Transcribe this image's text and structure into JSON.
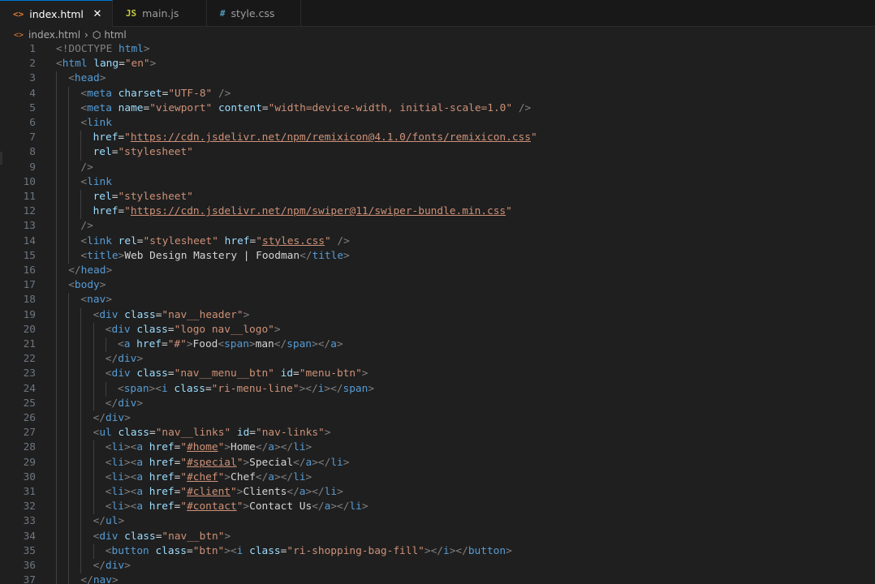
{
  "tabs": [
    {
      "label": "index.html",
      "icon": "<>",
      "icon_color": "#e37933",
      "active": true
    },
    {
      "label": "main.js",
      "icon": "JS",
      "icon_color": "#cbcb41",
      "active": false
    },
    {
      "label": "style.css",
      "icon": "#",
      "icon_color": "#519aba",
      "active": false
    }
  ],
  "breadcrumb": {
    "file": "index.html",
    "symbol": "html"
  },
  "lines": [
    {
      "n": "1",
      "indent": 0,
      "tokens": [
        [
          "punct",
          "<!DOCTYPE "
        ],
        [
          "tag",
          "html"
        ],
        [
          "punct",
          ">"
        ]
      ]
    },
    {
      "n": "2",
      "indent": 0,
      "tokens": [
        [
          "punct",
          "<"
        ],
        [
          "tag",
          "html"
        ],
        [
          "text",
          " "
        ],
        [
          "attr",
          "lang"
        ],
        [
          "text",
          "="
        ],
        [
          "str",
          "\"en\""
        ],
        [
          "punct",
          ">"
        ]
      ]
    },
    {
      "n": "3",
      "indent": 1,
      "tokens": [
        [
          "punct",
          "<"
        ],
        [
          "tag",
          "head"
        ],
        [
          "punct",
          ">"
        ]
      ]
    },
    {
      "n": "4",
      "indent": 2,
      "tokens": [
        [
          "punct",
          "<"
        ],
        [
          "tag",
          "meta"
        ],
        [
          "text",
          " "
        ],
        [
          "attr",
          "charset"
        ],
        [
          "text",
          "="
        ],
        [
          "str",
          "\"UTF-8\""
        ],
        [
          "text",
          " "
        ],
        [
          "punct",
          "/>"
        ]
      ]
    },
    {
      "n": "5",
      "indent": 2,
      "tokens": [
        [
          "punct",
          "<"
        ],
        [
          "tag",
          "meta"
        ],
        [
          "text",
          " "
        ],
        [
          "attr",
          "name"
        ],
        [
          "text",
          "="
        ],
        [
          "str",
          "\"viewport\""
        ],
        [
          "text",
          " "
        ],
        [
          "attr",
          "content"
        ],
        [
          "text",
          "="
        ],
        [
          "str",
          "\"width=device-width, initial-scale=1.0\""
        ],
        [
          "text",
          " "
        ],
        [
          "punct",
          "/>"
        ]
      ]
    },
    {
      "n": "6",
      "indent": 2,
      "tokens": [
        [
          "punct",
          "<"
        ],
        [
          "tag",
          "link"
        ]
      ]
    },
    {
      "n": "7",
      "indent": 3,
      "tokens": [
        [
          "attr",
          "href"
        ],
        [
          "text",
          "="
        ],
        [
          "str",
          "\""
        ],
        [
          "link",
          "https://cdn.jsdelivr.net/npm/remixicon@4.1.0/fonts/remixicon.css"
        ],
        [
          "str",
          "\""
        ]
      ]
    },
    {
      "n": "8",
      "indent": 3,
      "tokens": [
        [
          "attr",
          "rel"
        ],
        [
          "text",
          "="
        ],
        [
          "str",
          "\"stylesheet\""
        ]
      ]
    },
    {
      "n": "9",
      "indent": 2,
      "tokens": [
        [
          "punct",
          "/>"
        ]
      ]
    },
    {
      "n": "10",
      "indent": 2,
      "tokens": [
        [
          "punct",
          "<"
        ],
        [
          "tag",
          "link"
        ]
      ]
    },
    {
      "n": "11",
      "indent": 3,
      "tokens": [
        [
          "attr",
          "rel"
        ],
        [
          "text",
          "="
        ],
        [
          "str",
          "\"stylesheet\""
        ]
      ]
    },
    {
      "n": "12",
      "indent": 3,
      "tokens": [
        [
          "attr",
          "href"
        ],
        [
          "text",
          "="
        ],
        [
          "str",
          "\""
        ],
        [
          "link",
          "https://cdn.jsdelivr.net/npm/swiper@11/swiper-bundle.min.css"
        ],
        [
          "str",
          "\""
        ]
      ]
    },
    {
      "n": "13",
      "indent": 2,
      "tokens": [
        [
          "punct",
          "/>"
        ]
      ]
    },
    {
      "n": "14",
      "indent": 2,
      "tokens": [
        [
          "punct",
          "<"
        ],
        [
          "tag",
          "link"
        ],
        [
          "text",
          " "
        ],
        [
          "attr",
          "rel"
        ],
        [
          "text",
          "="
        ],
        [
          "str",
          "\"stylesheet\""
        ],
        [
          "text",
          " "
        ],
        [
          "attr",
          "href"
        ],
        [
          "text",
          "="
        ],
        [
          "str",
          "\""
        ],
        [
          "link",
          "styles.css"
        ],
        [
          "str",
          "\""
        ],
        [
          "text",
          " "
        ],
        [
          "punct",
          "/>"
        ]
      ]
    },
    {
      "n": "15",
      "indent": 2,
      "tokens": [
        [
          "punct",
          "<"
        ],
        [
          "tag",
          "title"
        ],
        [
          "punct",
          ">"
        ],
        [
          "text",
          "Web Design Mastery | Foodman"
        ],
        [
          "punct",
          "</"
        ],
        [
          "tag",
          "title"
        ],
        [
          "punct",
          ">"
        ]
      ]
    },
    {
      "n": "16",
      "indent": 1,
      "tokens": [
        [
          "punct",
          "</"
        ],
        [
          "tag",
          "head"
        ],
        [
          "punct",
          ">"
        ]
      ]
    },
    {
      "n": "17",
      "indent": 1,
      "tokens": [
        [
          "punct",
          "<"
        ],
        [
          "tag",
          "body"
        ],
        [
          "punct",
          ">"
        ]
      ]
    },
    {
      "n": "18",
      "indent": 2,
      "tokens": [
        [
          "punct",
          "<"
        ],
        [
          "tag",
          "nav"
        ],
        [
          "punct",
          ">"
        ]
      ]
    },
    {
      "n": "19",
      "indent": 3,
      "tokens": [
        [
          "punct",
          "<"
        ],
        [
          "tag",
          "div"
        ],
        [
          "text",
          " "
        ],
        [
          "attr",
          "class"
        ],
        [
          "text",
          "="
        ],
        [
          "str",
          "\"nav__header\""
        ],
        [
          "punct",
          ">"
        ]
      ]
    },
    {
      "n": "20",
      "indent": 4,
      "tokens": [
        [
          "punct",
          "<"
        ],
        [
          "tag",
          "div"
        ],
        [
          "text",
          " "
        ],
        [
          "attr",
          "class"
        ],
        [
          "text",
          "="
        ],
        [
          "str",
          "\"logo nav__logo\""
        ],
        [
          "punct",
          ">"
        ]
      ]
    },
    {
      "n": "21",
      "indent": 5,
      "tokens": [
        [
          "punct",
          "<"
        ],
        [
          "tag",
          "a"
        ],
        [
          "text",
          " "
        ],
        [
          "attr",
          "href"
        ],
        [
          "text",
          "="
        ],
        [
          "str",
          "\"#\""
        ],
        [
          "punct",
          ">"
        ],
        [
          "text",
          "Food"
        ],
        [
          "punct",
          "<"
        ],
        [
          "tag",
          "span"
        ],
        [
          "punct",
          ">"
        ],
        [
          "text",
          "man"
        ],
        [
          "punct",
          "</"
        ],
        [
          "tag",
          "span"
        ],
        [
          "punct",
          "></"
        ],
        [
          "tag",
          "a"
        ],
        [
          "punct",
          ">"
        ]
      ]
    },
    {
      "n": "22",
      "indent": 4,
      "tokens": [
        [
          "punct",
          "</"
        ],
        [
          "tag",
          "div"
        ],
        [
          "punct",
          ">"
        ]
      ]
    },
    {
      "n": "23",
      "indent": 4,
      "tokens": [
        [
          "punct",
          "<"
        ],
        [
          "tag",
          "div"
        ],
        [
          "text",
          " "
        ],
        [
          "attr",
          "class"
        ],
        [
          "text",
          "="
        ],
        [
          "str",
          "\"nav__menu__btn\""
        ],
        [
          "text",
          " "
        ],
        [
          "attr",
          "id"
        ],
        [
          "text",
          "="
        ],
        [
          "str",
          "\"menu-btn\""
        ],
        [
          "punct",
          ">"
        ]
      ]
    },
    {
      "n": "24",
      "indent": 5,
      "tokens": [
        [
          "punct",
          "<"
        ],
        [
          "tag",
          "span"
        ],
        [
          "punct",
          "><"
        ],
        [
          "tag",
          "i"
        ],
        [
          "text",
          " "
        ],
        [
          "attr",
          "class"
        ],
        [
          "text",
          "="
        ],
        [
          "str",
          "\"ri-menu-line\""
        ],
        [
          "punct",
          "></"
        ],
        [
          "tag",
          "i"
        ],
        [
          "punct",
          "></"
        ],
        [
          "tag",
          "span"
        ],
        [
          "punct",
          ">"
        ]
      ]
    },
    {
      "n": "25",
      "indent": 4,
      "tokens": [
        [
          "punct",
          "</"
        ],
        [
          "tag",
          "div"
        ],
        [
          "punct",
          ">"
        ]
      ]
    },
    {
      "n": "26",
      "indent": 3,
      "tokens": [
        [
          "punct",
          "</"
        ],
        [
          "tag",
          "div"
        ],
        [
          "punct",
          ">"
        ]
      ]
    },
    {
      "n": "27",
      "indent": 3,
      "tokens": [
        [
          "punct",
          "<"
        ],
        [
          "tag",
          "ul"
        ],
        [
          "text",
          " "
        ],
        [
          "attr",
          "class"
        ],
        [
          "text",
          "="
        ],
        [
          "str",
          "\"nav__links\""
        ],
        [
          "text",
          " "
        ],
        [
          "attr",
          "id"
        ],
        [
          "text",
          "="
        ],
        [
          "str",
          "\"nav-links\""
        ],
        [
          "punct",
          ">"
        ]
      ]
    },
    {
      "n": "28",
      "indent": 4,
      "tokens": [
        [
          "punct",
          "<"
        ],
        [
          "tag",
          "li"
        ],
        [
          "punct",
          "><"
        ],
        [
          "tag",
          "a"
        ],
        [
          "text",
          " "
        ],
        [
          "attr",
          "href"
        ],
        [
          "text",
          "="
        ],
        [
          "str",
          "\""
        ],
        [
          "link",
          "#home"
        ],
        [
          "str",
          "\""
        ],
        [
          "punct",
          ">"
        ],
        [
          "text",
          "Home"
        ],
        [
          "punct",
          "</"
        ],
        [
          "tag",
          "a"
        ],
        [
          "punct",
          "></"
        ],
        [
          "tag",
          "li"
        ],
        [
          "punct",
          ">"
        ]
      ]
    },
    {
      "n": "29",
      "indent": 4,
      "tokens": [
        [
          "punct",
          "<"
        ],
        [
          "tag",
          "li"
        ],
        [
          "punct",
          "><"
        ],
        [
          "tag",
          "a"
        ],
        [
          "text",
          " "
        ],
        [
          "attr",
          "href"
        ],
        [
          "text",
          "="
        ],
        [
          "str",
          "\""
        ],
        [
          "link",
          "#special"
        ],
        [
          "str",
          "\""
        ],
        [
          "punct",
          ">"
        ],
        [
          "text",
          "Special"
        ],
        [
          "punct",
          "</"
        ],
        [
          "tag",
          "a"
        ],
        [
          "punct",
          "></"
        ],
        [
          "tag",
          "li"
        ],
        [
          "punct",
          ">"
        ]
      ]
    },
    {
      "n": "30",
      "indent": 4,
      "tokens": [
        [
          "punct",
          "<"
        ],
        [
          "tag",
          "li"
        ],
        [
          "punct",
          "><"
        ],
        [
          "tag",
          "a"
        ],
        [
          "text",
          " "
        ],
        [
          "attr",
          "href"
        ],
        [
          "text",
          "="
        ],
        [
          "str",
          "\""
        ],
        [
          "link",
          "#chef"
        ],
        [
          "str",
          "\""
        ],
        [
          "punct",
          ">"
        ],
        [
          "text",
          "Chef"
        ],
        [
          "punct",
          "</"
        ],
        [
          "tag",
          "a"
        ],
        [
          "punct",
          "></"
        ],
        [
          "tag",
          "li"
        ],
        [
          "punct",
          ">"
        ]
      ]
    },
    {
      "n": "31",
      "indent": 4,
      "tokens": [
        [
          "punct",
          "<"
        ],
        [
          "tag",
          "li"
        ],
        [
          "punct",
          "><"
        ],
        [
          "tag",
          "a"
        ],
        [
          "text",
          " "
        ],
        [
          "attr",
          "href"
        ],
        [
          "text",
          "="
        ],
        [
          "str",
          "\""
        ],
        [
          "link",
          "#client"
        ],
        [
          "str",
          "\""
        ],
        [
          "punct",
          ">"
        ],
        [
          "text",
          "Clients"
        ],
        [
          "punct",
          "</"
        ],
        [
          "tag",
          "a"
        ],
        [
          "punct",
          "></"
        ],
        [
          "tag",
          "li"
        ],
        [
          "punct",
          ">"
        ]
      ]
    },
    {
      "n": "32",
      "indent": 4,
      "tokens": [
        [
          "punct",
          "<"
        ],
        [
          "tag",
          "li"
        ],
        [
          "punct",
          "><"
        ],
        [
          "tag",
          "a"
        ],
        [
          "text",
          " "
        ],
        [
          "attr",
          "href"
        ],
        [
          "text",
          "="
        ],
        [
          "str",
          "\""
        ],
        [
          "link",
          "#contact"
        ],
        [
          "str",
          "\""
        ],
        [
          "punct",
          ">"
        ],
        [
          "text",
          "Contact Us"
        ],
        [
          "punct",
          "</"
        ],
        [
          "tag",
          "a"
        ],
        [
          "punct",
          "></"
        ],
        [
          "tag",
          "li"
        ],
        [
          "punct",
          ">"
        ]
      ]
    },
    {
      "n": "33",
      "indent": 3,
      "tokens": [
        [
          "punct",
          "</"
        ],
        [
          "tag",
          "ul"
        ],
        [
          "punct",
          ">"
        ]
      ]
    },
    {
      "n": "34",
      "indent": 3,
      "tokens": [
        [
          "punct",
          "<"
        ],
        [
          "tag",
          "div"
        ],
        [
          "text",
          " "
        ],
        [
          "attr",
          "class"
        ],
        [
          "text",
          "="
        ],
        [
          "str",
          "\"nav__btn\""
        ],
        [
          "punct",
          ">"
        ]
      ]
    },
    {
      "n": "35",
      "indent": 4,
      "tokens": [
        [
          "punct",
          "<"
        ],
        [
          "tag",
          "button"
        ],
        [
          "text",
          " "
        ],
        [
          "attr",
          "class"
        ],
        [
          "text",
          "="
        ],
        [
          "str",
          "\"btn\""
        ],
        [
          "punct",
          "><"
        ],
        [
          "tag",
          "i"
        ],
        [
          "text",
          " "
        ],
        [
          "attr",
          "class"
        ],
        [
          "text",
          "="
        ],
        [
          "str",
          "\"ri-shopping-bag-fill\""
        ],
        [
          "punct",
          "></"
        ],
        [
          "tag",
          "i"
        ],
        [
          "punct",
          "></"
        ],
        [
          "tag",
          "button"
        ],
        [
          "punct",
          ">"
        ]
      ]
    },
    {
      "n": "36",
      "indent": 3,
      "tokens": [
        [
          "punct",
          "</"
        ],
        [
          "tag",
          "div"
        ],
        [
          "punct",
          ">"
        ]
      ]
    },
    {
      "n": "37",
      "indent": 2,
      "tokens": [
        [
          "punct",
          "</"
        ],
        [
          "tag",
          "nav"
        ],
        [
          "punct",
          ">"
        ]
      ]
    }
  ]
}
